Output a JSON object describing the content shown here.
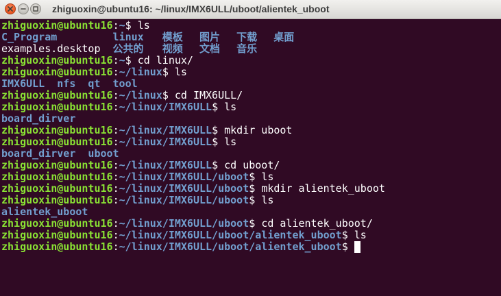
{
  "window": {
    "title": "zhiguoxin@ubuntu16: ~/linux/IMX6ULL/uboot/alientek_uboot",
    "controls": {
      "close": "close-icon",
      "minimize": "minimize-icon",
      "maximize": "maximize-icon"
    }
  },
  "colors": {
    "terminal_background": "#300a24",
    "user_host": "#8ae234",
    "path": "#729fcf",
    "directory": "#729fcf",
    "text": "#ffffff",
    "cursor": "#ffffff",
    "close_button": "#e95420"
  },
  "prompt": {
    "user_host": "zhiguoxin@ubuntu16",
    "separator": ":",
    "symbol": "$"
  },
  "terminal": {
    "lines": [
      {
        "kind": "prompt",
        "path": "~",
        "command": "ls"
      },
      {
        "kind": "listing",
        "rows": [
          [
            {
              "name": "C_Program",
              "type": "directory"
            },
            {
              "name": "linux",
              "type": "directory"
            },
            {
              "name": "模板",
              "type": "directory"
            },
            {
              "name": "图片",
              "type": "directory"
            },
            {
              "name": "下载",
              "type": "directory"
            },
            {
              "name": "桌面",
              "type": "directory"
            }
          ],
          [
            {
              "name": "examples.desktop",
              "type": "file"
            },
            {
              "name": "公共的",
              "type": "directory"
            },
            {
              "name": "视频",
              "type": "directory"
            },
            {
              "name": "文档",
              "type": "directory"
            },
            {
              "name": "音乐",
              "type": "directory"
            }
          ]
        ]
      },
      {
        "kind": "prompt",
        "path": "~",
        "command": "cd linux/"
      },
      {
        "kind": "prompt",
        "path": "~/linux",
        "command": "ls"
      },
      {
        "kind": "listing",
        "rows": [
          [
            {
              "name": "IMX6ULL",
              "type": "directory"
            },
            {
              "name": "nfs",
              "type": "directory"
            },
            {
              "name": "qt",
              "type": "directory"
            },
            {
              "name": "tool",
              "type": "directory"
            }
          ]
        ]
      },
      {
        "kind": "prompt",
        "path": "~/linux",
        "command": "cd IMX6ULL/"
      },
      {
        "kind": "prompt",
        "path": "~/linux/IMX6ULL",
        "command": "ls"
      },
      {
        "kind": "listing",
        "rows": [
          [
            {
              "name": "board_dirver",
              "type": "directory"
            }
          ]
        ]
      },
      {
        "kind": "prompt",
        "path": "~/linux/IMX6ULL",
        "command": "mkdir uboot"
      },
      {
        "kind": "prompt",
        "path": "~/linux/IMX6ULL",
        "command": "ls"
      },
      {
        "kind": "listing",
        "rows": [
          [
            {
              "name": "board_dirver",
              "type": "directory"
            },
            {
              "name": "uboot",
              "type": "directory"
            }
          ]
        ]
      },
      {
        "kind": "prompt",
        "path": "~/linux/IMX6ULL",
        "command": "cd uboot/"
      },
      {
        "kind": "prompt",
        "path": "~/linux/IMX6ULL/uboot",
        "command": "ls"
      },
      {
        "kind": "prompt",
        "path": "~/linux/IMX6ULL/uboot",
        "command": "mkdir alientek_uboot"
      },
      {
        "kind": "prompt",
        "path": "~/linux/IMX6ULL/uboot",
        "command": "ls"
      },
      {
        "kind": "listing",
        "rows": [
          [
            {
              "name": "alientek_uboot",
              "type": "directory"
            }
          ]
        ]
      },
      {
        "kind": "prompt",
        "path": "~/linux/IMX6ULL/uboot",
        "command": "cd alientek_uboot/"
      },
      {
        "kind": "prompt",
        "path": "~/linux/IMX6ULL/uboot/alientek_uboot",
        "command": "ls"
      },
      {
        "kind": "prompt",
        "path": "~/linux/IMX6ULL/uboot/alientek_uboot",
        "command": "",
        "cursor": true
      }
    ]
  }
}
